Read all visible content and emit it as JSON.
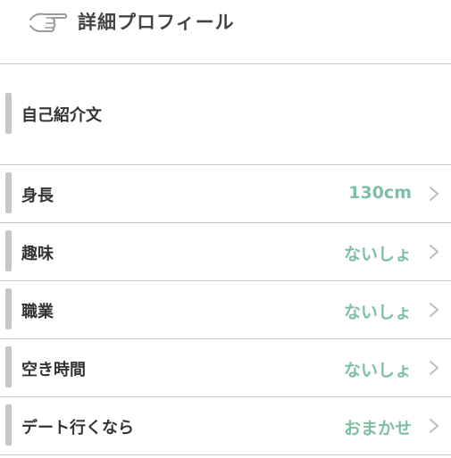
{
  "header": {
    "title": "詳細プロフィール",
    "icon": "pointing-hand-icon"
  },
  "intro": {
    "label": "自己紹介文"
  },
  "rows": [
    {
      "label": "身長",
      "value": "130cm"
    },
    {
      "label": "趣味",
      "value": "ないしょ"
    },
    {
      "label": "職業",
      "value": "ないしょ"
    },
    {
      "label": "空き時間",
      "value": "ないしょ"
    },
    {
      "label": "デート行くなら",
      "value": "おまかせ"
    }
  ],
  "colors": {
    "value_text": "#7fbfa3",
    "accent_bar": "#c6c6c6",
    "divider": "#c8c8c8"
  }
}
